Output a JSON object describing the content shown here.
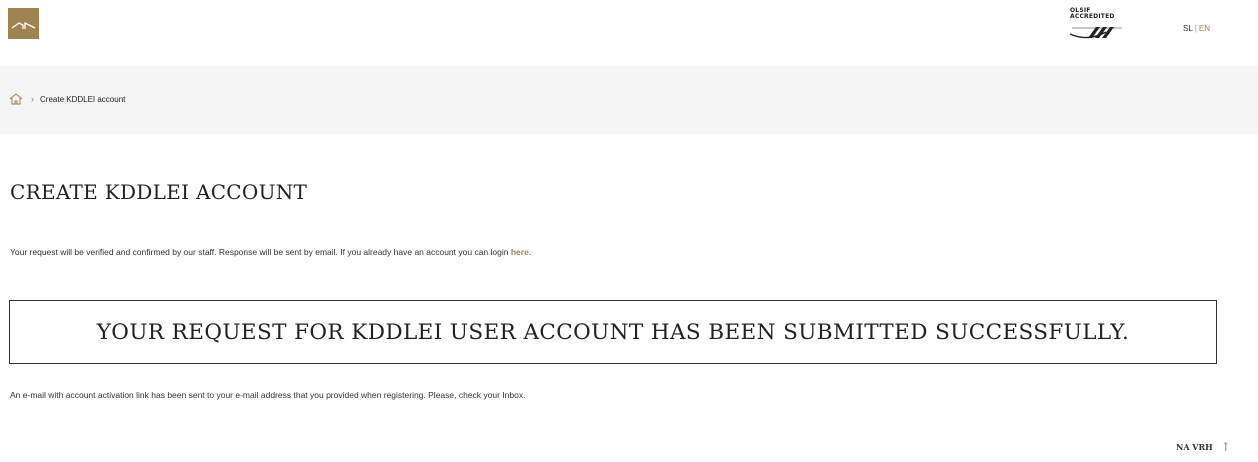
{
  "header": {
    "partner_logo_text": "OLSIF\nACCREDITED",
    "lang": {
      "sl": "SL",
      "separator": "|",
      "en": "EN"
    }
  },
  "breadcrumb": {
    "home_icon": "home-icon",
    "current": "Create KDDLEI account"
  },
  "main": {
    "title": "CREATE KDDLEI ACCOUNT",
    "intro_text": "Your request will be verified and confirmed by our staff. Response will be sent by email. If you already have an account you can login ",
    "intro_link": "here",
    "intro_end": ".",
    "success_message": "YOUR REQUEST FOR KDDLEI USER ACCOUNT HAS BEEN SUBMITTED SUCCESSFULLY.",
    "activation_text": "An e-mail with account activation link has been sent to your e-mail address that you provided when registering. Please, check your Inbox."
  },
  "footer": {
    "to_top_label": "NA VRH",
    "to_top_icon": "arrow-up-icon"
  },
  "colors": {
    "brand_gold": "#a08352",
    "breadcrumb_bg": "#f5f5f5",
    "text": "#222222"
  }
}
